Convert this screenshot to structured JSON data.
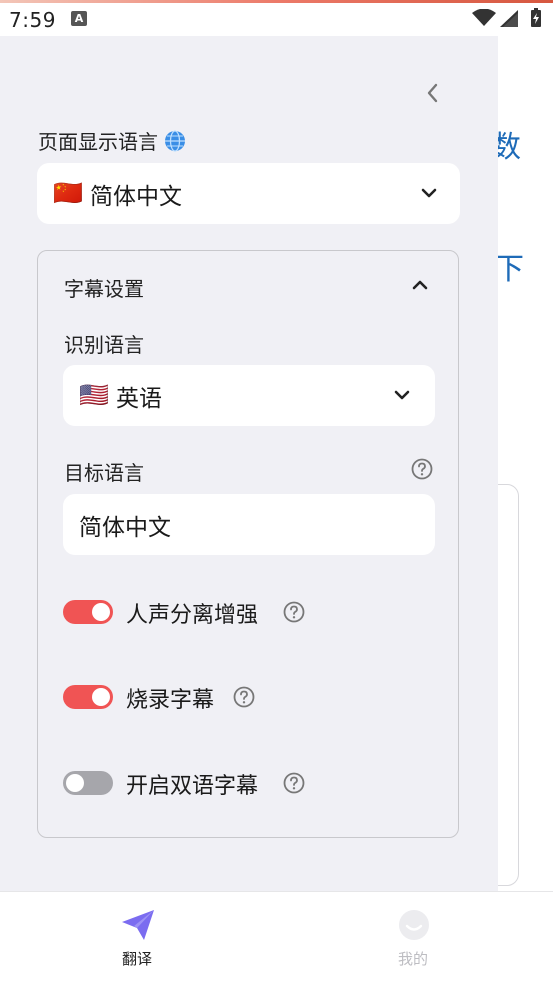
{
  "status_bar": {
    "time": "7:59",
    "notification_glyph": "A"
  },
  "background_app": {
    "char_1": "数",
    "char_2": "下"
  },
  "drawer": {
    "page_language_label": "页面显示语言",
    "page_language": {
      "flag": "🇨🇳",
      "value": "简体中文"
    },
    "subtitle_settings": {
      "title": "字幕设置",
      "recognition_label": "识别语言",
      "recognition": {
        "flag": "🇺🇸",
        "value": "英语"
      },
      "target_label": "目标语言",
      "target_value": "简体中文",
      "toggles": [
        {
          "label": "人声分离增强",
          "on": true
        },
        {
          "label": "烧录字幕",
          "on": true
        },
        {
          "label": "开启双语字幕",
          "on": false
        }
      ]
    }
  },
  "bottom_nav": {
    "items": [
      {
        "label": "翻译",
        "active": true
      },
      {
        "label": "我的",
        "active": false
      }
    ]
  },
  "colors": {
    "toggle_on": "#f05454",
    "toggle_off": "#a6a6ab",
    "nav_active": "#7b6cf0",
    "bg_accent": "#1e6bb8"
  }
}
